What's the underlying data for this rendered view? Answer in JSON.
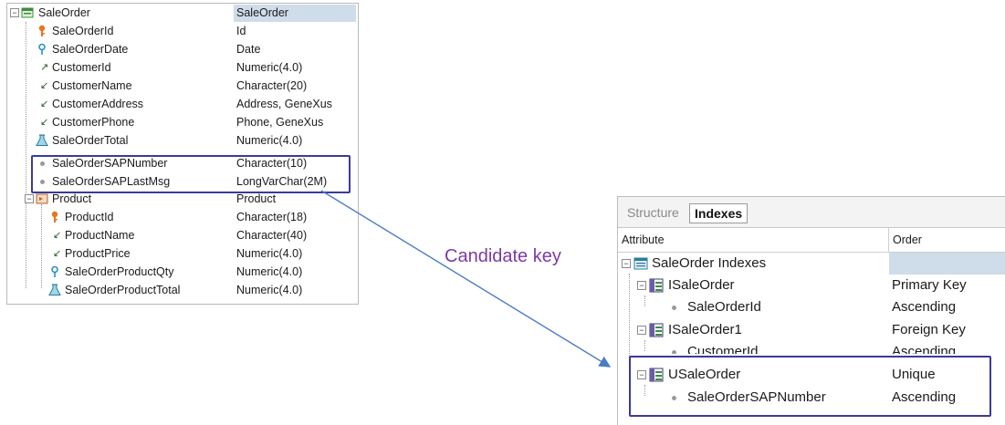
{
  "structure": {
    "root": {
      "name": "SaleOrder",
      "type": "SaleOrder",
      "icon": "transaction-icon"
    },
    "attributes": [
      {
        "name": "SaleOrderId",
        "type": "Id",
        "icon": "primary-key-icon"
      },
      {
        "name": "SaleOrderDate",
        "type": "Date",
        "icon": "candidate-key-icon"
      },
      {
        "name": "CustomerId",
        "type": "Numeric(4.0)",
        "icon": "foreign-key-icon"
      },
      {
        "name": "CustomerName",
        "type": "Character(20)",
        "icon": "inferred-icon"
      },
      {
        "name": "CustomerAddress",
        "type": "Address, GeneXus",
        "icon": "inferred-icon"
      },
      {
        "name": "CustomerPhone",
        "type": "Phone, GeneXus",
        "icon": "inferred-icon"
      },
      {
        "name": "SaleOrderTotal",
        "type": "Numeric(4.0)",
        "icon": "formula-icon"
      },
      {
        "name": "SaleOrderSAPNumber",
        "type": "Character(10)",
        "icon": "bullet-icon"
      },
      {
        "name": "SaleOrderSAPLastMsg",
        "type": "LongVarChar(2M)",
        "icon": "bullet-icon"
      }
    ],
    "level": {
      "name": "Product",
      "type": "Product",
      "icon": "level-icon"
    },
    "level_attributes": [
      {
        "name": "ProductId",
        "type": "Character(18)",
        "icon": "primary-key-icon"
      },
      {
        "name": "ProductName",
        "type": "Character(40)",
        "icon": "inferred-icon"
      },
      {
        "name": "ProductPrice",
        "type": "Numeric(4.0)",
        "icon": "inferred-icon"
      },
      {
        "name": "SaleOrderProductQty",
        "type": "Numeric(4.0)",
        "icon": "candidate-key-icon"
      },
      {
        "name": "SaleOrderProductTotal",
        "type": "Numeric(4.0)",
        "icon": "formula-icon"
      }
    ]
  },
  "annotation": {
    "label": "Candidate key"
  },
  "indexes_panel": {
    "tabs": [
      {
        "label": "Structure",
        "active": false
      },
      {
        "label": "Indexes",
        "active": true
      }
    ],
    "columns": {
      "attribute": "Attribute",
      "order": "Order"
    },
    "root": {
      "name": "SaleOrder Indexes",
      "icon": "indexes-icon"
    },
    "indexes": [
      {
        "name": "ISaleOrder",
        "order": "Primary Key",
        "attribute": "SaleOrderId",
        "attribute_order": "Ascending"
      },
      {
        "name": "ISaleOrder1",
        "order": "Foreign Key",
        "attribute": "CustomerId",
        "attribute_order": "Ascending"
      },
      {
        "name": "USaleOrder",
        "order": "Unique",
        "attribute": "SaleOrderSAPNumber",
        "attribute_order": "Ascending"
      }
    ]
  },
  "colors": {
    "highlight_box": "#3c3a9a",
    "annotation_text": "#7c3aa6",
    "arrow": "#4a7cc4",
    "selection": "#cfdce9"
  }
}
